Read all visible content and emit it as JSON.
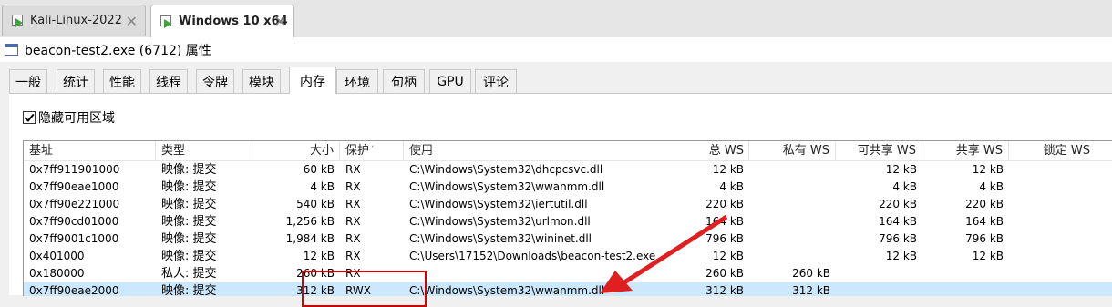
{
  "vm_tabs": [
    {
      "label": "Kali-Linux-2022",
      "close": "✕"
    },
    {
      "label": "Windows 10 x64",
      "close": "✕"
    }
  ],
  "window": {
    "title": "beacon-test2.exe (6712) 属性",
    "icon": "window-icon"
  },
  "tabs": [
    "一般",
    "统计",
    "性能",
    "线程",
    "令牌",
    "模块",
    "内存",
    "环境",
    "句柄",
    "GPU",
    "评论"
  ],
  "active_tab": "内存",
  "hide_free": {
    "label": "隐藏可用区域",
    "checked": true
  },
  "table": {
    "columns": [
      "基址",
      "类型",
      "大小",
      "保护",
      "使用",
      "总 WS",
      "私有 WS",
      "可共享 WS",
      "共享 WS",
      "锁定 WS"
    ],
    "sort_column": "保护",
    "rows": [
      [
        "0x7ff911901000",
        "映像: 提交",
        "60 kB",
        "RX",
        "C:\\Windows\\System32\\dhcpcsvc.dll",
        "12 kB",
        "",
        "12 kB",
        "12 kB",
        ""
      ],
      [
        "0x7ff90eae1000",
        "映像: 提交",
        "4 kB",
        "RX",
        "C:\\Windows\\System32\\wwanmm.dll",
        "4 kB",
        "",
        "4 kB",
        "4 kB",
        ""
      ],
      [
        "0x7ff90e221000",
        "映像: 提交",
        "540 kB",
        "RX",
        "C:\\Windows\\System32\\iertutil.dll",
        "220 kB",
        "",
        "220 kB",
        "220 kB",
        ""
      ],
      [
        "0x7ff90cd01000",
        "映像: 提交",
        "1,256 kB",
        "RX",
        "C:\\Windows\\System32\\urlmon.dll",
        "164 kB",
        "",
        "164 kB",
        "164 kB",
        ""
      ],
      [
        "0x7ff9001c1000",
        "映像: 提交",
        "1,984 kB",
        "RX",
        "C:\\Windows\\System32\\wininet.dll",
        "796 kB",
        "",
        "796 kB",
        "796 kB",
        ""
      ],
      [
        "0x401000",
        "映像: 提交",
        "12 kB",
        "RX",
        "C:\\Users\\17152\\Downloads\\beacon-test2.exe",
        "12 kB",
        "",
        "12 kB",
        "12 kB",
        ""
      ],
      [
        "0x180000",
        "私人: 提交",
        "260 kB",
        "RX",
        "",
        "260 kB",
        "260 kB",
        "",
        "",
        ""
      ],
      [
        "0x7ff90eae2000",
        "映像: 提交",
        "312 kB",
        "RWX",
        "C:\\Windows\\System32\\wwanmm.dll",
        "312 kB",
        "312 kB",
        "",
        "",
        ""
      ]
    ],
    "selected_row": 7
  },
  "annotation": {
    "box_color": "#d40000",
    "arrow_color": "#e02020"
  }
}
